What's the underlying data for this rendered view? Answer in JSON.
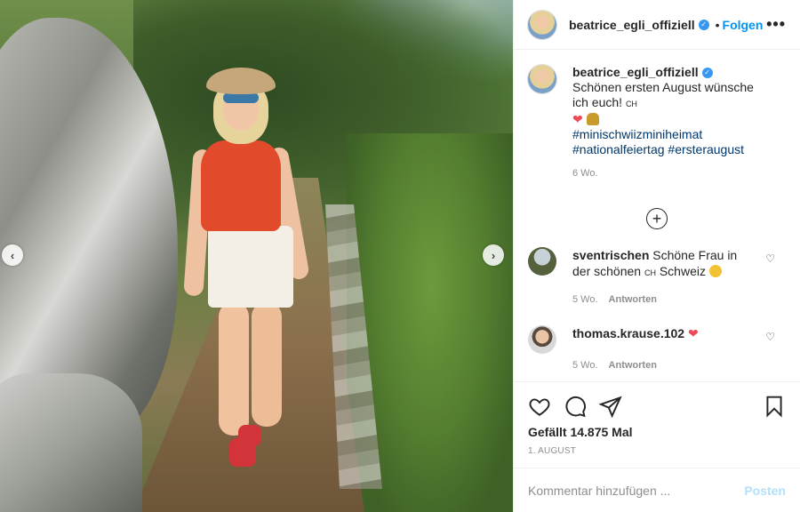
{
  "post": {
    "author": "beatrice_egli_offiziell",
    "follow_label": "Folgen",
    "more_label": "•••",
    "separator": "•"
  },
  "caption": {
    "author": "beatrice_egli_offiziell",
    "text": "Schönen ersten August wünsche ich euch!",
    "flag": "CH",
    "hashtags": [
      "#minischwiizminiheimat",
      "#nationalfeiertag #ersteraugust"
    ],
    "time": "6 Wo."
  },
  "comments": [
    {
      "username": "sventrischen",
      "text": "Schöne Frau in der schönen",
      "flag": "CH",
      "text2": "Schweiz",
      "time": "5 Wo.",
      "reply_label": "Antworten"
    },
    {
      "username": "thomas.krause.102",
      "text": "",
      "time": "5 Wo.",
      "reply_label": "Antworten"
    }
  ],
  "stats": {
    "likes": "Gefällt 14.875 Mal",
    "date": "1. AUGUST"
  },
  "add_comment": {
    "placeholder": "Kommentar hinzufügen ...",
    "post_label": "Posten"
  },
  "icons": {
    "prev": "chevron-left-icon",
    "next": "chevron-right-icon",
    "like": "heart-icon",
    "comment": "comment-icon",
    "share": "paper-plane-icon",
    "save": "bookmark-icon",
    "load_more": "plus-circle-icon"
  },
  "colors": {
    "accent": "#0095f6",
    "verified": "#3897f0",
    "heart": "#ed4956",
    "muted": "#8e8e8e"
  }
}
